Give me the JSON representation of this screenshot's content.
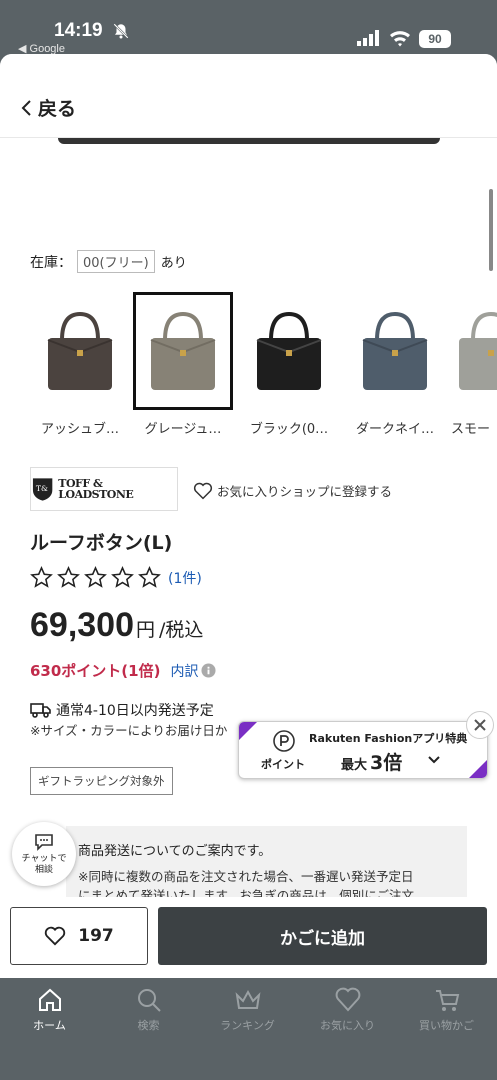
{
  "status_bar": {
    "time": "14:19",
    "back_app": "◀ Google",
    "battery": "90"
  },
  "header": {
    "back_label": "戻る"
  },
  "stock": {
    "label": "在庫：",
    "size": "00(フリー)",
    "status": "あり"
  },
  "colors": [
    {
      "label": "アッシュブ…",
      "color": "#4b433f",
      "selected": false
    },
    {
      "label": "グレージュ…",
      "color": "#878276",
      "selected": true
    },
    {
      "label": "ブラック(0…",
      "color": "#1e1e1e",
      "selected": false
    },
    {
      "label": "ダークネイ…",
      "color": "#4f5d6b",
      "selected": false
    },
    {
      "label": "スモー",
      "color": "#9fa09a",
      "selected": false
    }
  ],
  "brand": {
    "logo_text": "TOFF & LOADSTONE",
    "favorite_shop": "お気に入りショップに登録する"
  },
  "product": {
    "name": "ルーフボタン(L)",
    "rating": 0,
    "review_count": "(1件)",
    "price": "69,300",
    "price_yen": "円",
    "price_tax": "/税込",
    "points": "630ポイント(1倍)",
    "points_breakdown": "内訳"
  },
  "shipping": {
    "estimate": "通常4-10日以内発送予定",
    "note": "※サイズ・カラーによりお届け日か"
  },
  "promo": {
    "point_label": "ポイント",
    "title": "Rakuten Fashionアプリ特典",
    "multiplier_prefix": "最大",
    "multiplier_value": "3倍"
  },
  "gift_badge": "ギフトラッピング対象外",
  "notice": {
    "title": "商品発送についてのご案内です。",
    "body_line1": "※同時に複数の商品を注文された場合、一番遅い発送予定日",
    "body_line2": "にまとめて発送いたします。お急ぎの商品は、個別にご注文"
  },
  "chat": {
    "label_line1": "チャットで",
    "label_line2": "相談"
  },
  "actions": {
    "like_count": "197",
    "add_to_cart": "かごに追加"
  },
  "tabs": [
    {
      "label": "ホーム",
      "icon": "home-icon",
      "active": true
    },
    {
      "label": "検索",
      "icon": "search-icon",
      "active": false
    },
    {
      "label": "ランキング",
      "icon": "crown-icon",
      "active": false
    },
    {
      "label": "お気に入り",
      "icon": "heart-icon",
      "active": false
    },
    {
      "label": "買い物かご",
      "icon": "cart-icon",
      "active": false
    }
  ],
  "theme": {
    "accent_points": "#c12b4b",
    "link": "#1c5bb3",
    "promo_purple": "#7a2fc4",
    "dark_button": "#3c4144"
  }
}
